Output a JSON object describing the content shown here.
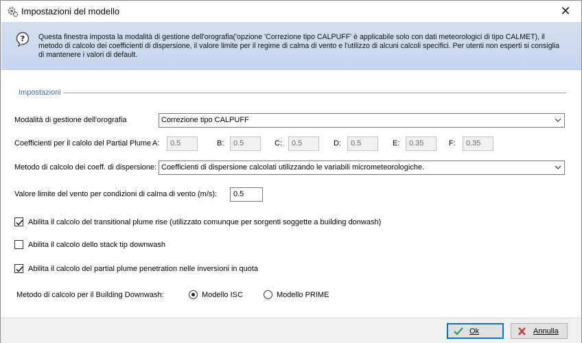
{
  "window": {
    "title": "Impostazioni del modello",
    "close_label": "✕"
  },
  "info": {
    "text": "Questa finestra imposta la modalità di gestione dell'orografia('opzione 'Correzione tipo CALPUFF' è applicabile solo con dati meteorologici di tipo CALMET), il metodo di calcolo dei coefficienti di dispersione, il valore limite per il regime di calma di vento e l'utilizzo di alcuni calcoli specifici. Per utenti non esperti si consiglia di mantenere i valori di default."
  },
  "group": {
    "legend": "Impostazioni"
  },
  "orography": {
    "label": "Modalità di gestione dell'orografia",
    "value": "Correzione tipo CALPUFF"
  },
  "partial_plume": {
    "label": "Coefficienti per il calolo del Partial Plume",
    "coefficients": [
      {
        "name": "A:",
        "value": "0.5"
      },
      {
        "name": "B:",
        "value": "0.5"
      },
      {
        "name": "C:",
        "value": "0.5"
      },
      {
        "name": "D:",
        "value": "0.5"
      },
      {
        "name": "E:",
        "value": "0.35"
      },
      {
        "name": "F:",
        "value": "0.35"
      }
    ]
  },
  "dispersion": {
    "label": "Metodo di calcolo dei coeff. di dispersione:",
    "value": "Coefficienti di dispersione calcolati utilizzando le variabili micrometeorologiche."
  },
  "wind_limit": {
    "label": "Valore limite del vento per condizioni di calma di vento (m/s):",
    "value": "0.5"
  },
  "checkboxes": [
    {
      "label": "Abilita il calcolo del transitional plume rise (utilizzato comunque per sorgenti soggette a building donwash)",
      "checked": true
    },
    {
      "label": "Abilita il calcolo dello stack tip downwash",
      "checked": false
    },
    {
      "label": "Abilita il calcolo del partial plume penetration nelle inversioni in quota",
      "checked": true
    }
  ],
  "downwash": {
    "label": "Metodo di calcolo per il Building Downwash:",
    "options": [
      {
        "label": "Modello ISC",
        "selected": true
      },
      {
        "label": "Modello PRIME",
        "selected": false
      }
    ]
  },
  "buttons": {
    "ok": "Ok",
    "cancel": "Annulla"
  },
  "colors": {
    "banner": "#c6d6ee",
    "legend": "#3b6db8",
    "ok_icon": "#2fa84f",
    "cancel_icon": "#d0342c"
  }
}
